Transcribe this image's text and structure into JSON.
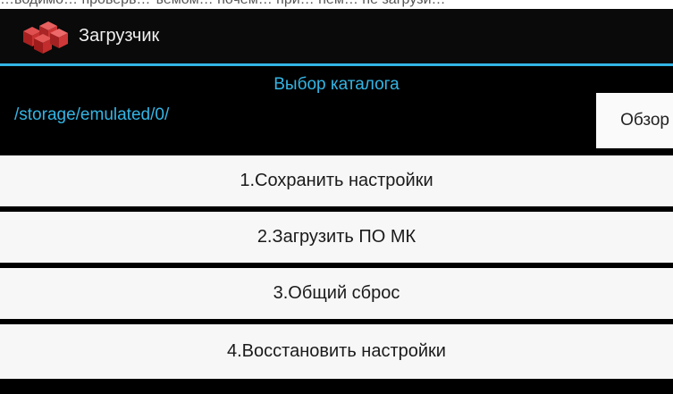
{
  "top_strip": {
    "text": "…водимо… проверь… ъемом… ночем… при… нем… не загрузи…"
  },
  "app": {
    "title": "Загрузчик",
    "icon": "red-cubes-logo-icon"
  },
  "directory": {
    "heading": "Выбор каталога",
    "path": "/storage/emulated/0/",
    "browse_label": "Обзор"
  },
  "actions": [
    {
      "label": "1.Сохранить настройки"
    },
    {
      "label": "2.Загрузить ПО МК"
    },
    {
      "label": "3.Общий сброс"
    },
    {
      "label": "4.Восстановить настройки"
    }
  ],
  "colors": {
    "accent": "#33b5e5",
    "background": "#000000",
    "button": "#f7f7f7"
  }
}
